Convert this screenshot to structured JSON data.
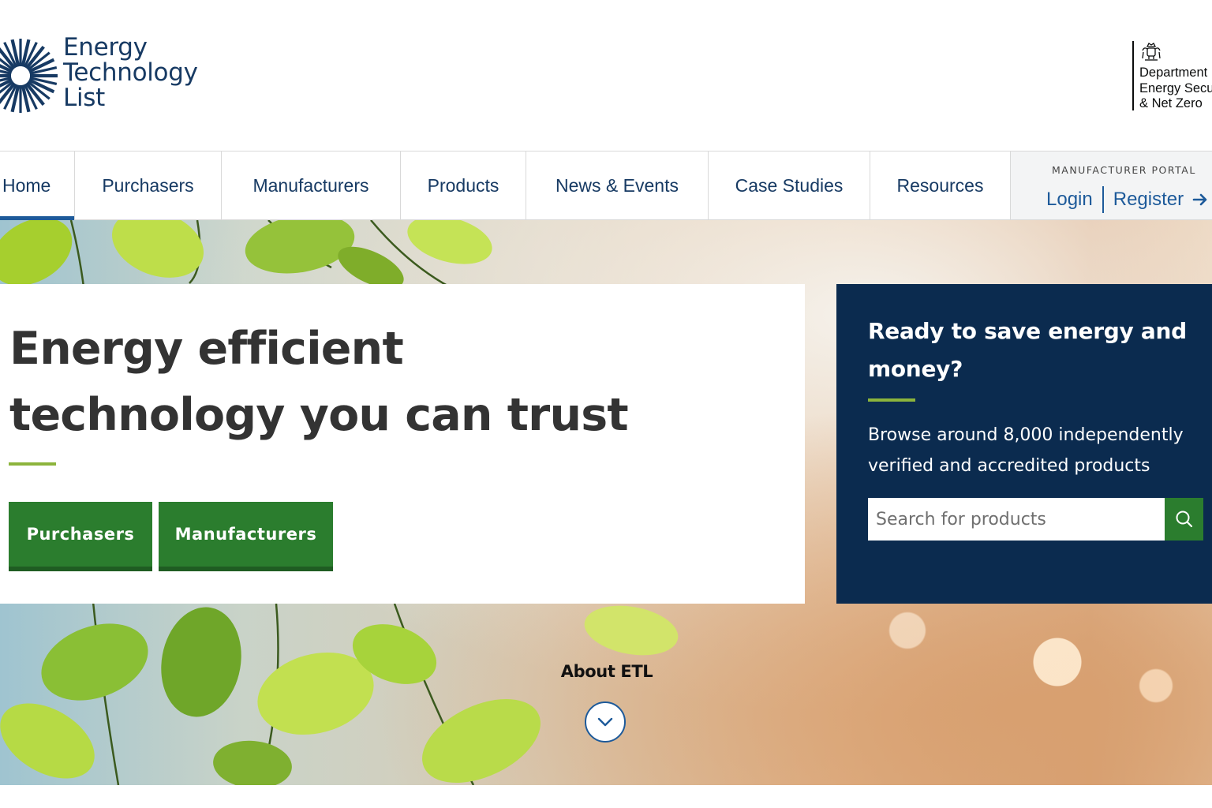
{
  "header": {
    "logo_lines": [
      "Energy",
      "Technology",
      "List"
    ],
    "logo_icon": "sunburst-logo-icon",
    "dept_lines": [
      "Department",
      "Energy Secu",
      "& Net Zero"
    ],
    "dept_icon": "royal-crest-icon"
  },
  "nav": {
    "items": [
      {
        "label": "Home",
        "active": true
      },
      {
        "label": "Purchasers"
      },
      {
        "label": "Manufacturers"
      },
      {
        "label": "Products"
      },
      {
        "label": "News & Events"
      },
      {
        "label": "Case Studies"
      },
      {
        "label": "Resources"
      }
    ],
    "portal_label": "MANUFACTURER PORTAL",
    "login_label": "Login",
    "register_label": "Register",
    "register_icon": "arrow-right-icon"
  },
  "hero": {
    "title_lines": [
      "Energy efficient",
      "technology you can trust"
    ],
    "buttons": {
      "purchasers": "Purchasers",
      "manufacturers": "Manufacturers"
    },
    "about_label": "About ETL",
    "about_icon": "chevron-down-icon"
  },
  "cta": {
    "title": "Ready to save energy and money?",
    "text": "Browse around 8,000 independently verified and accredited products",
    "search_placeholder": "Search for products",
    "search_icon": "search-icon"
  },
  "colors": {
    "brand_navy": "#173a63",
    "link_blue": "#1d5a9a",
    "green_button": "#2b7d2e",
    "accent_green": "#8cb43c",
    "panel_navy": "#0b2b4f"
  }
}
